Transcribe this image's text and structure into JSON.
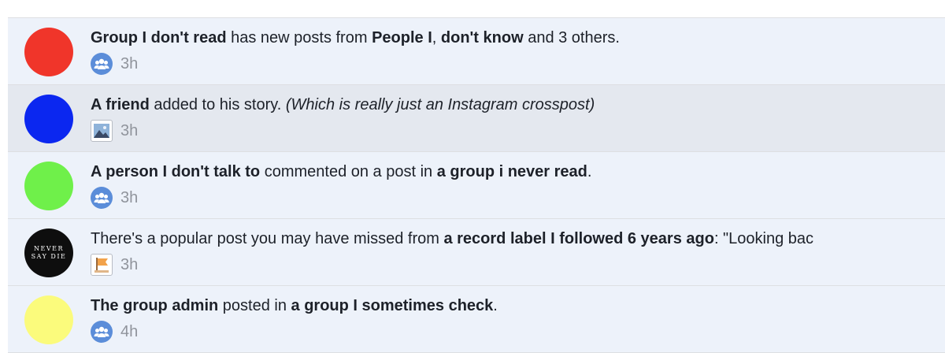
{
  "notifications": [
    {
      "avatar_color": "#f0352a",
      "icon": "group-icon",
      "parts": {
        "a": "Group I don't read",
        "b": " has new posts from ",
        "c": "People I",
        "d": ", ",
        "e": "don't know",
        "f": " and 3 others."
      },
      "time": "3h"
    },
    {
      "avatar_color": "#0b27f0",
      "icon": "photo-icon",
      "parts": {
        "a": "A friend",
        "b": " added to his story. ",
        "c": "(Which is really just an Instagram crosspost)"
      },
      "time": "3h"
    },
    {
      "avatar_color": "#6ff04a",
      "icon": "group-icon",
      "parts": {
        "a": "A person I don't talk to",
        "b": " commented on a post in ",
        "c": "a group i never read",
        "d": "."
      },
      "time": "3h"
    },
    {
      "avatar_text": [
        "NEVER",
        "SAY DIE"
      ],
      "icon": "flag-icon",
      "parts": {
        "a": "There's a popular post you may have missed from ",
        "b": "a record label I followed 6 years ago",
        "c": ": \"Looking bac"
      },
      "time": "3h"
    },
    {
      "avatar_color": "#fbfb7c",
      "icon": "group-icon",
      "parts": {
        "a": "The group admin",
        "b": " posted in ",
        "c": "a group I sometimes check",
        "d": "."
      },
      "time": "4h"
    }
  ]
}
